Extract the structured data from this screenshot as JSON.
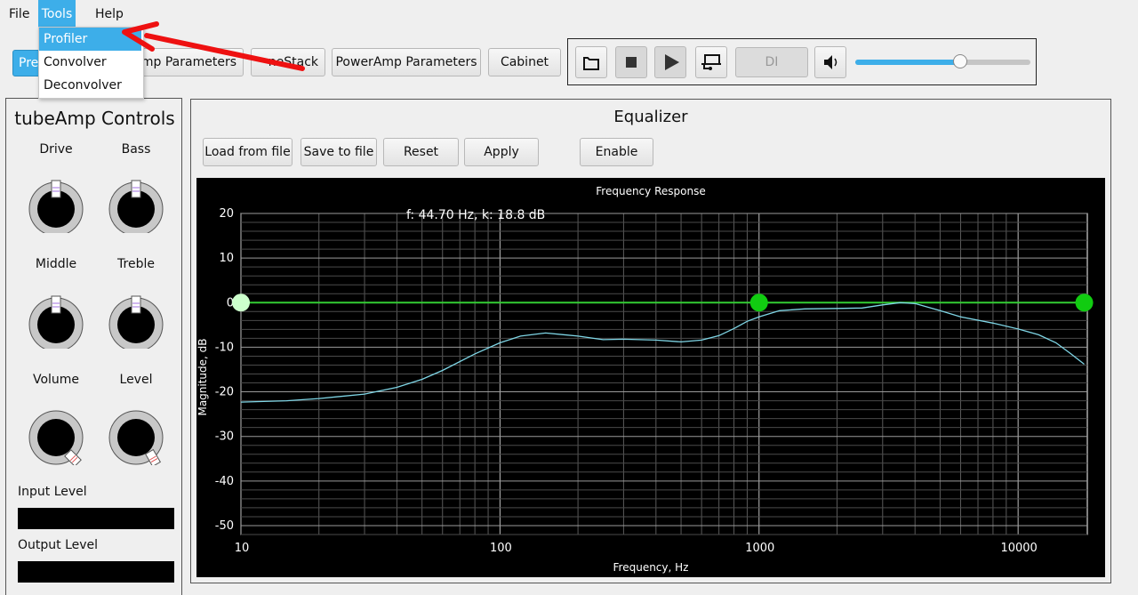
{
  "menubar": {
    "file": "File",
    "tools": "Tools",
    "help": "Help"
  },
  "tools_menu": {
    "items": [
      "Profiler",
      "Convolver",
      "Deconvolver"
    ],
    "highlighted": "Profiler"
  },
  "tabs": {
    "preamp_partial": "Pre",
    "tubeamp_partial": "Amp Parameters",
    "tonestack_partial": "neStack",
    "poweramp": "PowerAmp Parameters",
    "cabinet": "Cabinet"
  },
  "transport": {
    "di_label": "DI",
    "volume_level": 0.6
  },
  "controls": {
    "title": "tubeAmp Controls",
    "knobs": [
      {
        "label": "Drive"
      },
      {
        "label": "Bass"
      },
      {
        "label": "Middle"
      },
      {
        "label": "Treble"
      },
      {
        "label": "Volume"
      },
      {
        "label": "Level"
      }
    ],
    "input_level_label": "Input Level",
    "output_level_label": "Output Level"
  },
  "equalizer": {
    "title": "Equalizer",
    "buttons": {
      "load": "Load from file",
      "save": "Save to file",
      "reset": "Reset",
      "apply": "Apply",
      "enable": "Enable"
    }
  },
  "colors": {
    "accent": "#3daee9",
    "eq_line": "#33cc33",
    "response_curve": "#7fd6e6",
    "annotation_arrow": "#ee1111"
  },
  "chart_data": {
    "type": "line",
    "title": "Frequency Response",
    "xlabel": "Frequency, Hz",
    "ylabel": "Magnitude, dB",
    "xscale": "log",
    "xlim": [
      10,
      18500
    ],
    "ylim": [
      -52,
      20
    ],
    "x_ticks": [
      "10",
      "100",
      "1000",
      "10000"
    ],
    "x_tick_values": [
      10,
      100,
      1000,
      10000
    ],
    "y_ticks": [
      "20",
      "10",
      "0",
      "-10",
      "-20",
      "-30",
      "-40",
      "-50"
    ],
    "y_tick_values": [
      20,
      10,
      0,
      -10,
      -20,
      -30,
      -40,
      -50
    ],
    "grid": true,
    "annotation": "f: 44.70 Hz, k: 18.8 dB",
    "series": [
      {
        "x": [
          10,
          15,
          20,
          30,
          40,
          50,
          60,
          80,
          100,
          120,
          150,
          200,
          250,
          300,
          400,
          500,
          600,
          700,
          800,
          900,
          1000,
          1200,
          1500,
          2000,
          2500,
          3000,
          3500,
          4000,
          5000,
          6000,
          8000,
          10000,
          12000,
          14000,
          16000,
          18000
        ],
        "y": [
          -22.3,
          -22,
          -21.5,
          -20.5,
          -19,
          -17.2,
          -15.2,
          -11.5,
          -9,
          -7.5,
          -6.8,
          -7.5,
          -8.3,
          -8.2,
          -8.4,
          -8.8,
          -8.4,
          -7.4,
          -5.8,
          -4.2,
          -3.2,
          -1.8,
          -1.4,
          -1.3,
          -1.2,
          -0.5,
          0,
          -0.2,
          -1.8,
          -3.2,
          -4.6,
          -5.9,
          -7.2,
          -9.0,
          -11.5,
          -13.8
        ]
      }
    ],
    "eq_points": [
      {
        "x": 10,
        "y": 0,
        "selected": true
      },
      {
        "x": 1000,
        "y": 0,
        "selected": false
      },
      {
        "x": 18000,
        "y": 0,
        "selected": false
      }
    ]
  }
}
